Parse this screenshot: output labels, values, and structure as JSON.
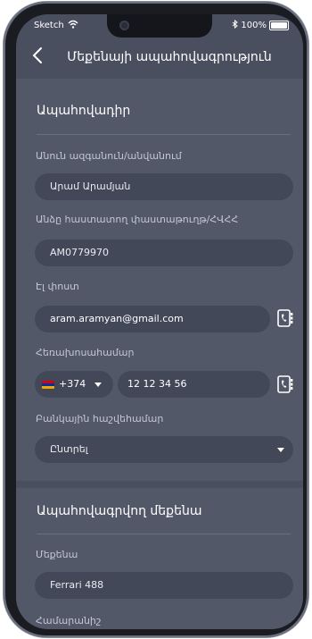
{
  "status_bar": {
    "carrier": "Sketch",
    "battery": "100%"
  },
  "nav": {
    "title": "Մեքենայի ապահովագրություն"
  },
  "insurer_section": {
    "title": "Ապահովադիր",
    "full_name": {
      "label": "Անուն ազգանուն/անվանում",
      "value": "Արամ Արամյան"
    },
    "id_document": {
      "label": "Անձը հաստատող փաստաթուղթ/ՀՎՀՀ",
      "value": "AM0779970"
    },
    "email": {
      "label": "Էլ փոստ",
      "value": "aram.aramyan@gmail.com"
    },
    "phone": {
      "label": "Հեռախոսահամար",
      "country_code": "+374",
      "number": "12 12 34 56"
    },
    "bank_account": {
      "label": "Բանկային հաշվեհամար",
      "placeholder": "Ընտրել"
    }
  },
  "vehicle_section": {
    "title": "Ապահովագրվող մեքենա",
    "car": {
      "label": "Մեքենա",
      "value": "Ferrari 488"
    },
    "plate": {
      "label": "Համարանիշ"
    }
  },
  "colors": {
    "screen_bg": "#4a4f60",
    "section_bg": "#535869",
    "field_bg": "#434858",
    "label_text": "#c3c7d2",
    "flag": [
      "#d90012",
      "#0033a0",
      "#f2a800"
    ]
  },
  "icons": {
    "back": "chevron-left-icon",
    "contacts": "contact-book-icon",
    "dropdown": "caret-down-icon",
    "wifi": "wifi-icon",
    "bluetooth": "bluetooth-icon",
    "battery": "battery-icon"
  }
}
